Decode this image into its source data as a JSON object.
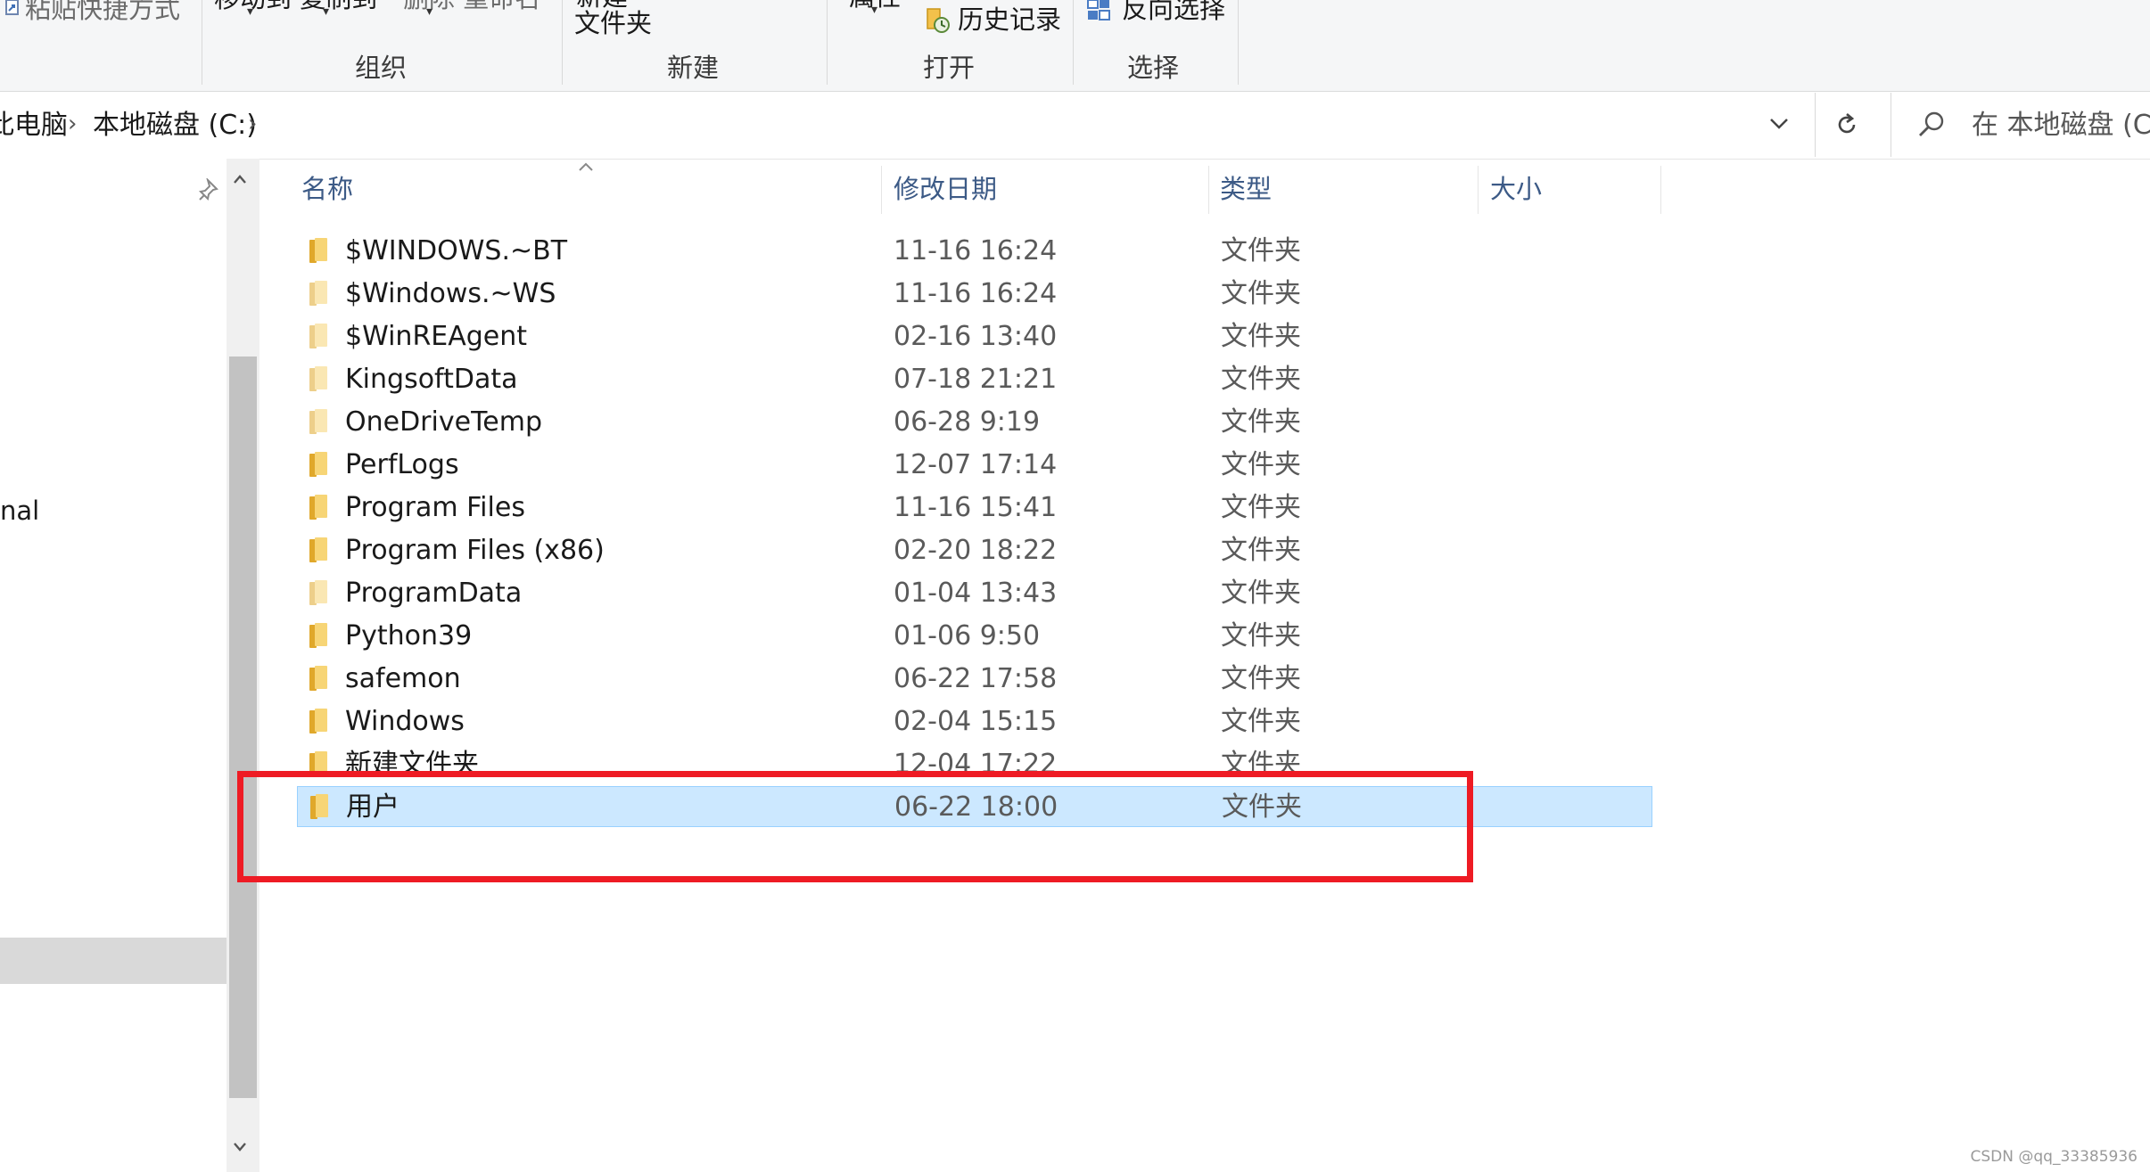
{
  "ribbon": {
    "top_items": {
      "paste_shortcut": "粘贴快捷方式",
      "move_copy": "移动到 复制到",
      "delete_rename": "删除 重命名",
      "new_item_top": "新建",
      "new_folder": "文件夹",
      "properties": "属性",
      "history": "历史记录",
      "invert_selection": "反向选择"
    },
    "groups": {
      "organize": "组织",
      "new": "新建",
      "open": "打开",
      "select": "选择"
    }
  },
  "address": {
    "crumb_pc": "此电脑",
    "crumb_drive": "本地磁盘 (C:)",
    "search_placeholder": "在 本地磁盘 (C:)"
  },
  "nav": {
    "partial_label": "nal"
  },
  "columns": {
    "name": "名称",
    "date": "修改日期",
    "type": "类型",
    "size": "大小"
  },
  "files": [
    {
      "name": "$WINDOWS.~BT",
      "date": "11-16 16:24",
      "type": "文件夹"
    },
    {
      "name": "$Windows.~WS",
      "date": "11-16 16:24",
      "type": "文件夹"
    },
    {
      "name": "$WinREAgent",
      "date": "02-16 13:40",
      "type": "文件夹"
    },
    {
      "name": "KingsoftData",
      "date": "07-18 21:21",
      "type": "文件夹"
    },
    {
      "name": "OneDriveTemp",
      "date": "06-28 9:19",
      "type": "文件夹"
    },
    {
      "name": "PerfLogs",
      "date": "12-07 17:14",
      "type": "文件夹"
    },
    {
      "name": "Program Files",
      "date": "11-16 15:41",
      "type": "文件夹"
    },
    {
      "name": "Program Files (x86)",
      "date": "02-20 18:22",
      "type": "文件夹"
    },
    {
      "name": "ProgramData",
      "date": "01-04 13:43",
      "type": "文件夹"
    },
    {
      "name": "Python39",
      "date": "01-06 9:50",
      "type": "文件夹"
    },
    {
      "name": "safemon",
      "date": "06-22 17:58",
      "type": "文件夹"
    },
    {
      "name": "Windows",
      "date": "02-04 15:15",
      "type": "文件夹"
    },
    {
      "name": "新建文件夹",
      "date": "12-04 17:22",
      "type": "文件夹"
    },
    {
      "name": "用户",
      "date": "06-22 18:00",
      "type": "文件夹"
    }
  ],
  "selected_file": "用户",
  "watermark": "CSDN @qq_33385936",
  "colors": {
    "selection": "#cce8ff",
    "highlight_box": "#ee1b24",
    "folder": "#f7d576"
  }
}
